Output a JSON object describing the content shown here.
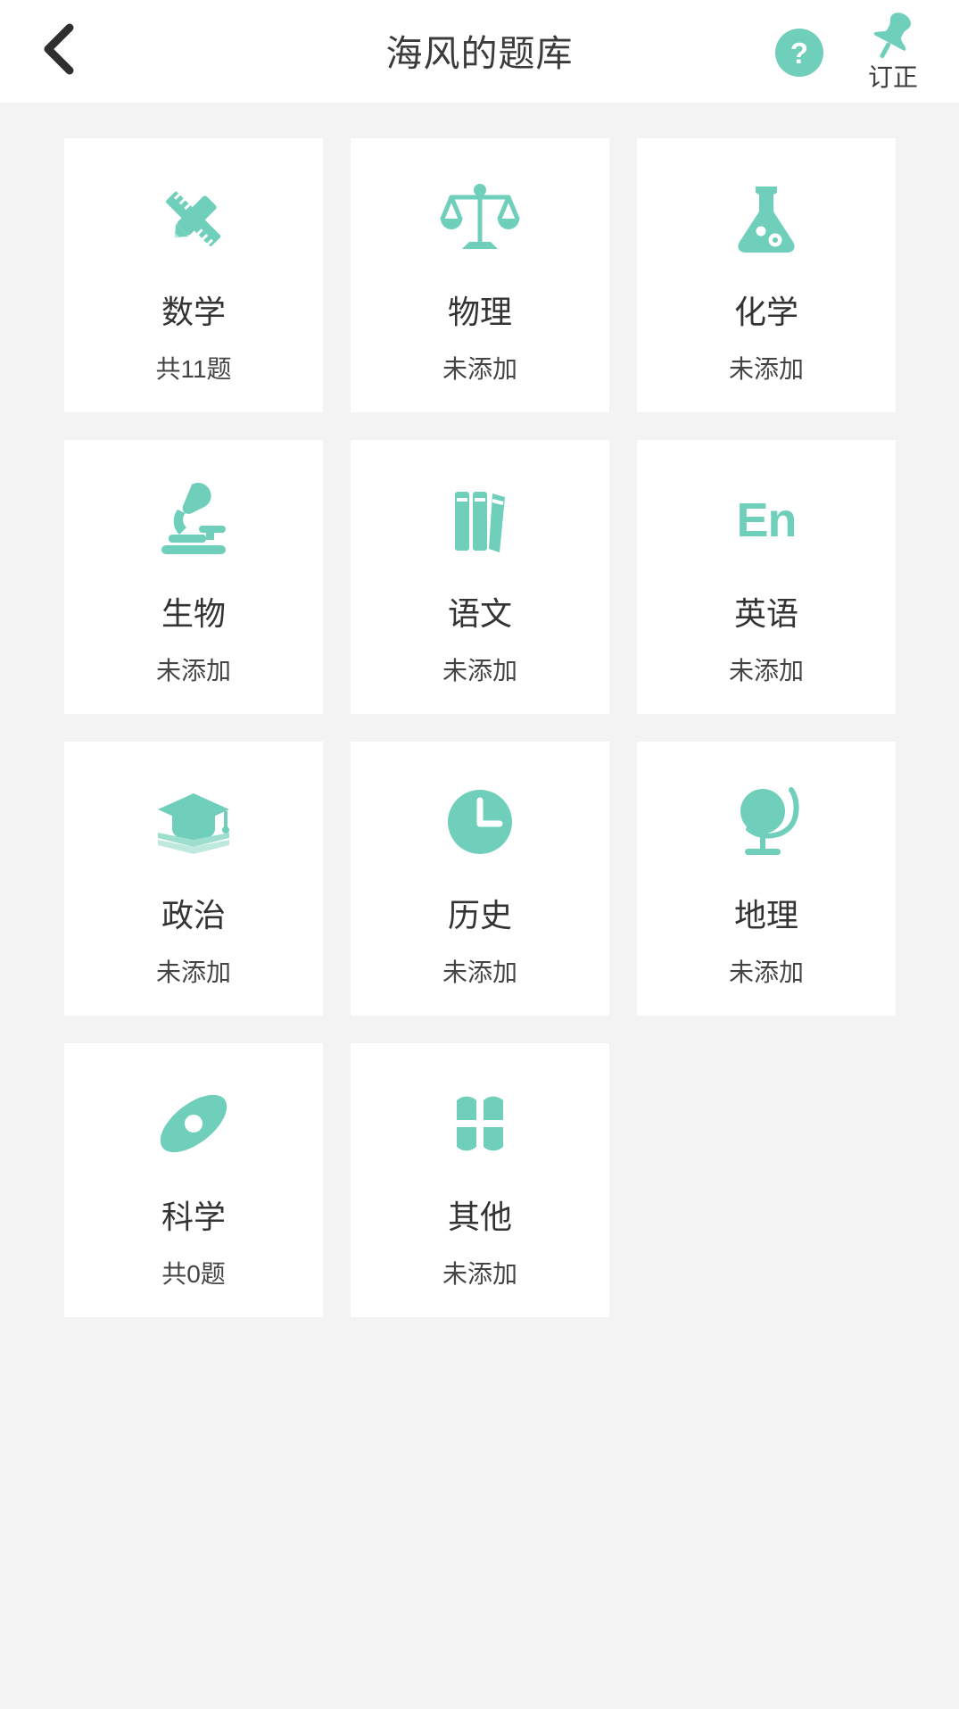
{
  "theme": {
    "accent": "#6fcfbb",
    "background": "#f2f3f2",
    "card_background": "#ffffff",
    "title_color": "#3b3b3b",
    "subtext_color": "#444444"
  },
  "header": {
    "title": "海风的题库",
    "back_icon": "chevron-left-icon",
    "help_icon": "question-mark-circle-icon",
    "pin_icon": "pushpin-icon",
    "pin_label": "订正"
  },
  "grid": {
    "cards": [
      {
        "title": "数学",
        "subtitle": "共11题",
        "icon": "pencil-ruler-icon"
      },
      {
        "title": "物理",
        "subtitle": "未添加",
        "icon": "balance-scale-icon"
      },
      {
        "title": "化学",
        "subtitle": "未添加",
        "icon": "flask-icon"
      },
      {
        "title": "生物",
        "subtitle": "未添加",
        "icon": "microscope-icon"
      },
      {
        "title": "语文",
        "subtitle": "未添加",
        "icon": "books-icon"
      },
      {
        "title": "英语",
        "subtitle": "未添加",
        "icon": "en-letters-icon",
        "icon_text": "En"
      },
      {
        "title": "政治",
        "subtitle": "未添加",
        "icon": "graduation-cap-icon"
      },
      {
        "title": "历史",
        "subtitle": "未添加",
        "icon": "clock-icon"
      },
      {
        "title": "地理",
        "subtitle": "未添加",
        "icon": "globe-icon"
      },
      {
        "title": "科学",
        "subtitle": "共0题",
        "icon": "atom-icon"
      },
      {
        "title": "其他",
        "subtitle": "未添加",
        "icon": "four-petal-icon"
      }
    ]
  }
}
